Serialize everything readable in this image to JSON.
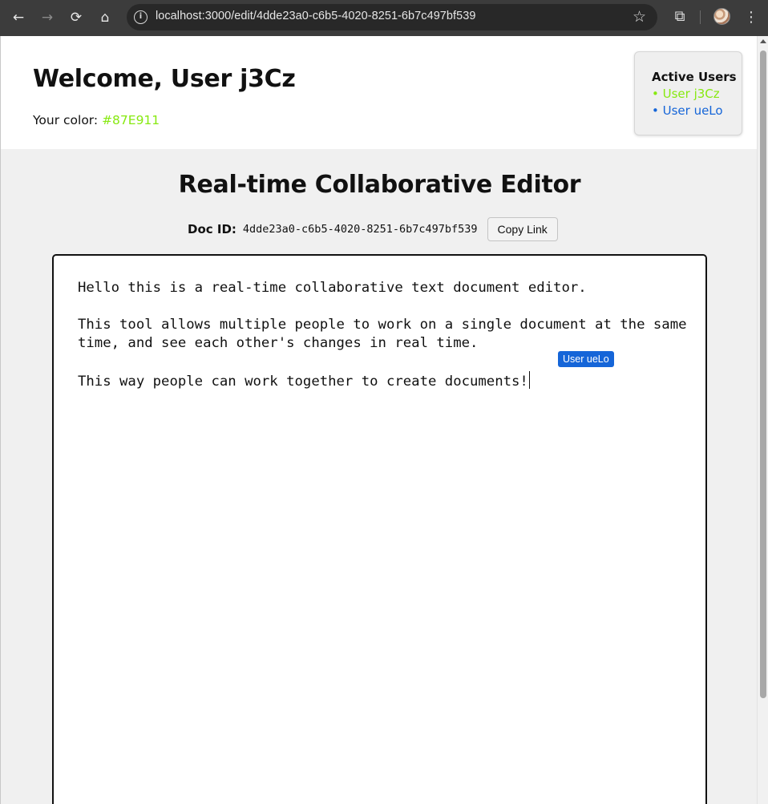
{
  "browser": {
    "url": "localhost:3000/edit/4dde23a0-c6b5-4020-8251-6b7c497bf539"
  },
  "header": {
    "welcome": "Welcome, User j3Cz",
    "color_label": "Your color: ",
    "color_value": "#87E911"
  },
  "active_users": {
    "title": "Active Users",
    "users": [
      {
        "label": "• User j3Cz",
        "color": "#87E911"
      },
      {
        "label": "• User ueLo",
        "color": "#1565D8"
      }
    ]
  },
  "main": {
    "title": "Real-time Collaborative Editor",
    "doc_id_label": "Doc ID:",
    "doc_id": "4dde23a0-c6b5-4020-8251-6b7c497bf539",
    "copy_label": "Copy Link"
  },
  "editor": {
    "paragraphs": [
      "Hello this is a real-time collaborative text document editor.",
      "This tool allows multiple people to work on a single document at the same time, and see each other's changes in real time.",
      "This way people can work together to create documents!"
    ],
    "remote_cursor_label": "User ueLo",
    "remote_cursor_color": "#1565D8"
  }
}
